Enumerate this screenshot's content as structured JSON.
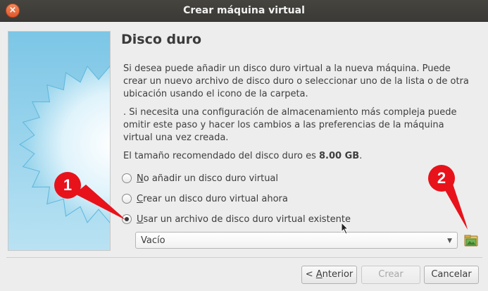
{
  "window": {
    "title": "Crear máquina virtual",
    "close_glyph": "×"
  },
  "page": {
    "heading": "Disco duro",
    "paragraph1": "Si desea puede añadir un disco duro virtual a la nueva máquina. Puede crear un nuevo archivo de disco duro o seleccionar uno de la lista o de otra ubicación usando el icono de la carpeta.",
    "paragraph2": ". Si necesita una configuración de almacenamiento más compleja puede omitir este paso y hacer los cambios a las preferencias de la máquina virtual una vez creada.",
    "recommended_prefix": "El tamaño recomendado del disco duro es ",
    "recommended_size": "8.00 GB",
    "recommended_suffix": "."
  },
  "options": [
    {
      "mnemonic": "N",
      "rest": "o añadir un disco duro virtual",
      "checked": false
    },
    {
      "mnemonic": "C",
      "rest": "rear un disco duro virtual ahora",
      "checked": false
    },
    {
      "mnemonic": "U",
      "rest": "sar un archivo de disco duro virtual existente",
      "checked": true
    }
  ],
  "file_select": {
    "value": "Vacío",
    "arrow": "▼",
    "icon": "folder-icon"
  },
  "buttons": {
    "back": {
      "prefix": "< ",
      "mnemonic": "A",
      "rest": "nterior"
    },
    "create": "Crear",
    "cancel": "Cancelar"
  },
  "annotations": {
    "marker1": "1",
    "marker2": "2",
    "color": "#e8121b"
  },
  "colors": {
    "titlebar": "#3b3a36",
    "close": "#e2572b",
    "sidebar_bg": "#9bd3ec"
  }
}
